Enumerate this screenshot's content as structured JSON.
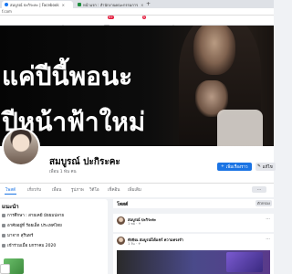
{
  "browser": {
    "tabs": [
      {
        "label": "สมบูรณ์ ปะกิระคะ | Facebook",
        "active": true
      },
      {
        "label": "หน้าแรก : สำนักงานคณะกรรมการ",
        "active": false
      }
    ],
    "new_tab_label": "+",
    "address": "f.com"
  },
  "fb_nav": {
    "icons": [
      "home-icon",
      "video-icon",
      "marketplace-icon",
      "groups-icon",
      "gaming-icon"
    ],
    "badges": {
      "video": "9+",
      "groups": "5"
    }
  },
  "cover": {
    "line1": "แค่ปีนี้พอนะ",
    "line2": "ปีหน้าฟ้าใหม่"
  },
  "profile": {
    "name": "สมบูรณ์ ปะกิระคะ",
    "friends": "เพื่อน 1 พัน คน",
    "add_story_label": "เพิ่มเรื่องราว",
    "edit_label": "แก้ไข"
  },
  "profile_tabs": {
    "items": [
      "โพสต์",
      "เกี่ยวกับ",
      "เพื่อน",
      "รูปภาพ",
      "วิดีโอ",
      "เช็คอิน",
      "เพิ่มเติม"
    ],
    "active_index": 0,
    "more_label": "···"
  },
  "intro": {
    "title": "แนะนำ",
    "rows": [
      "การศึกษา : สายเคมี มัธยมปลาย",
      "อาศัยอยู่ที่ ร้อยเอ็ด ประเทศไทย",
      "มาจาก สุรินทร์",
      "เข้าร่วมเมื่อ มกราคม 2020"
    ]
  },
  "feed": {
    "title": "โพสต์",
    "filter_label": "ตัวกรอง",
    "posts": [
      {
        "author": "สมบูรณ์ ปะกิระคะ",
        "meta": "1 ชม · ⚘"
      },
      {
        "author": "ทักษิณ สมบูรณ์ได้แชร์ ความทรงจำ",
        "meta": "1 วัน · ⚘"
      }
    ]
  },
  "colors": {
    "accent": "#1b74e4",
    "badge": "#e41e3f",
    "page_bg": "#f0f2f5"
  }
}
